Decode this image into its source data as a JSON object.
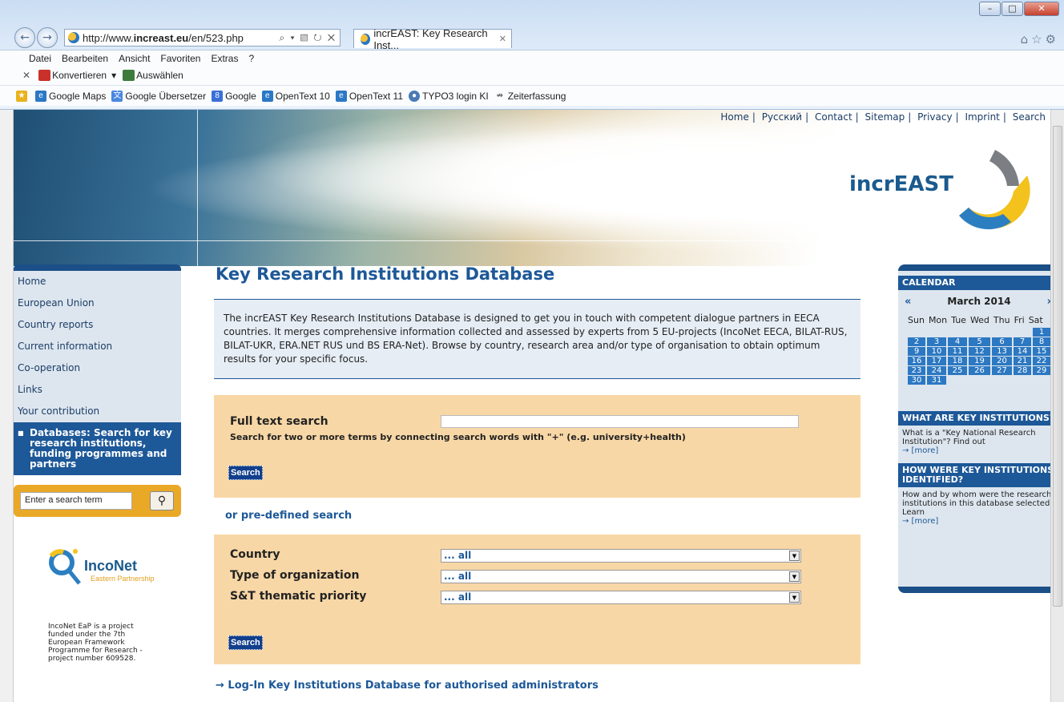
{
  "browser": {
    "url_prefix": "http://www.",
    "url_host": "increast.eu",
    "url_path": "/en/523.php",
    "address_tools": "⌕ ▾ ▨ ↻ ✕",
    "tab_title": "incrEAST: Key Research Inst...",
    "menu": [
      "Datei",
      "Bearbeiten",
      "Ansicht",
      "Favoriten",
      "Extras",
      "?"
    ],
    "cmd": {
      "convert": "Konvertieren",
      "select": "Auswählen"
    },
    "favorites": [
      "Google Maps",
      "Google Übersetzer",
      "Google",
      "OpenText 10",
      "OpenText 11",
      "TYPO3 login KI",
      "Zeiterfassung"
    ]
  },
  "topnav": [
    "Home",
    "Русский",
    "Contact",
    "Sitemap",
    "Privacy",
    "Imprint",
    "Search"
  ],
  "logo": {
    "part1": "incr",
    "part2": "EAST"
  },
  "leftnav": {
    "items": [
      "Home",
      "European Union",
      "Country reports",
      "Current information",
      "Co-operation",
      "Links",
      "Your contribution"
    ],
    "active": "Databases: Search for key research institutions, funding programmes and partners"
  },
  "left_search": {
    "placeholder": "Enter a search term"
  },
  "inconet": {
    "name": "IncoNet",
    "sub": "Eastern Partnership",
    "note": "IncoNet EaP is a project funded under the 7th European Framework Programme for Research - project number 609528."
  },
  "main": {
    "title": "Key Research Institutions Database",
    "intro": "The incrEAST Key Research Institutions Database is designed to get you in touch with competent dialogue partners in EECA countries. It merges comprehensive information collected and assessed by experts from 5 EU-projects (IncoNet EECA, BILAT-RUS, BILAT-UKR, ERA.NET RUS und BS ERA-Net). Browse by country, research area and/or type of organisation to obtain optimum results for your specific focus.",
    "fulltext": {
      "label": "Full text search",
      "hint": "Search for two or more terms by connecting search words with \"+\" (e.g. university+health)",
      "button": "Search"
    },
    "predefined_link": "or pre-defined search",
    "predefined": {
      "country_label": "Country",
      "type_label": "Type of organization",
      "priority_label": "S&T thematic priority",
      "country_value": "... all",
      "type_value": "... all",
      "priority_value": "... all",
      "button": "Search"
    },
    "login_link": "→ Log-In Key Institutions Database for authorised administrators"
  },
  "calendar": {
    "heading": "CALENDAR",
    "prev": "«",
    "next": "»",
    "month": "March 2014",
    "days": [
      "Sun",
      "Mon",
      "Tue",
      "Wed",
      "Thu",
      "Fri",
      "Sat"
    ],
    "dates": [
      "1",
      "2",
      "3",
      "4",
      "5",
      "6",
      "7",
      "8",
      "9",
      "10",
      "11",
      "12",
      "13",
      "14",
      "15",
      "16",
      "17",
      "18",
      "19",
      "20",
      "21",
      "22",
      "23",
      "24",
      "25",
      "26",
      "27",
      "28",
      "29",
      "30",
      "31"
    ]
  },
  "what_are": {
    "heading": "WHAT ARE KEY INSTITUTIONS?",
    "text": "What is a \"Key National Research Institution\"? Find out",
    "more": "→ [more]"
  },
  "how_were": {
    "heading": "HOW WERE KEY INSTITUTIONS IDENTIFIED?",
    "text": "How and by whom were the research institutions in this database selected? Learn",
    "more": "→ [more]"
  },
  "colors": {
    "brand_blue": "#1d5898",
    "accent_orange": "#eaa827",
    "panel_orange": "#f8d7a6",
    "panel_blue": "#dde6ef"
  }
}
